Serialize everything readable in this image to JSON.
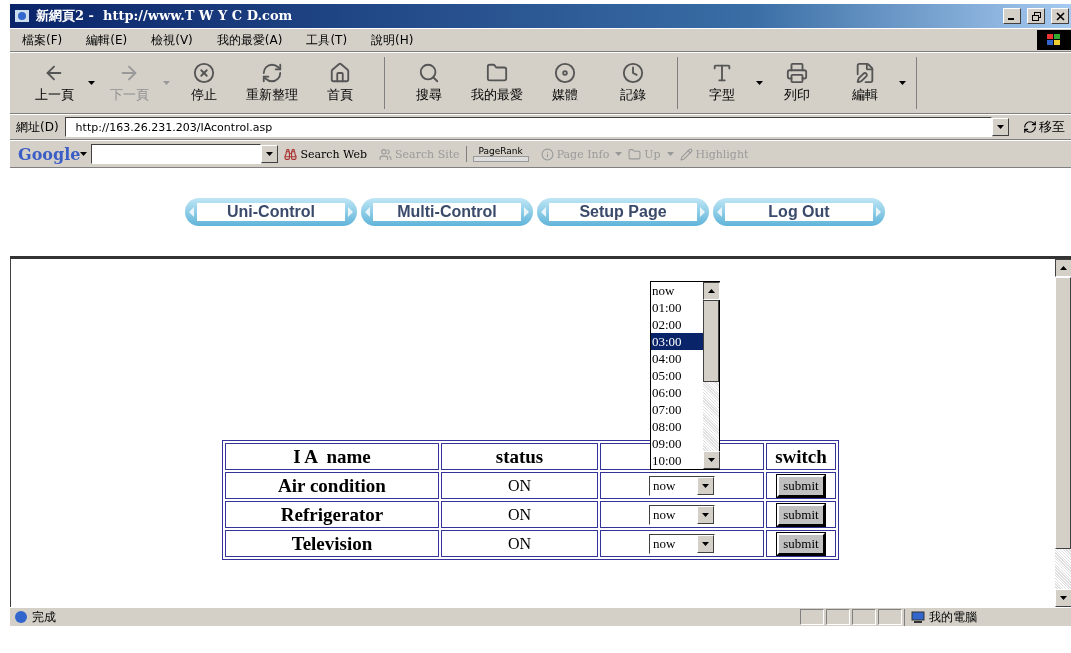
{
  "window": {
    "title": "新網頁2 -  http://www.T W Y C D.com"
  },
  "menu": [
    "檔案(F)",
    "編輯(E)",
    "檢視(V)",
    "我的最愛(A)",
    "工具(T)",
    "說明(H)"
  ],
  "toolbar": [
    [
      {
        "kind": "back",
        "label": "上一頁",
        "has_menu": true,
        "disabled": false
      },
      {
        "kind": "forward",
        "label": "下一頁",
        "has_menu": true,
        "disabled": true
      },
      {
        "kind": "stop",
        "label": "停止",
        "has_menu": false,
        "disabled": false
      },
      {
        "kind": "refresh",
        "label": "重新整理",
        "has_menu": false,
        "disabled": false
      },
      {
        "kind": "home",
        "label": "首頁",
        "has_menu": false,
        "disabled": false
      }
    ],
    [
      {
        "kind": "search",
        "label": "搜尋",
        "has_menu": false,
        "disabled": false
      },
      {
        "kind": "favorites",
        "label": "我的最愛",
        "has_menu": false,
        "disabled": false
      },
      {
        "kind": "media",
        "label": "媒體",
        "has_menu": false,
        "disabled": false
      },
      {
        "kind": "history",
        "label": "記錄",
        "has_menu": false,
        "disabled": false
      }
    ],
    [
      {
        "kind": "font",
        "label": "字型",
        "has_menu": true,
        "disabled": false
      },
      {
        "kind": "print",
        "label": "列印",
        "has_menu": false,
        "disabled": false
      },
      {
        "kind": "edit",
        "label": "編輯",
        "has_menu": true,
        "disabled": false
      }
    ]
  ],
  "address": {
    "label": "網址(D)",
    "value": "http://163.26.231.203/IAcontrol.asp",
    "go": "移至"
  },
  "google_bar": {
    "logo": "Google",
    "items": [
      {
        "kind": "search-web",
        "label": "Search Web",
        "disabled": false,
        "has_menu": false
      },
      {
        "kind": "search-site",
        "label": "Search Site",
        "disabled": true,
        "has_menu": false
      },
      {
        "kind": "pagerank",
        "label": "PageRank",
        "level": 0
      },
      {
        "kind": "page-info",
        "label": "Page Info",
        "disabled": true,
        "has_menu": true
      },
      {
        "kind": "up",
        "label": "Up",
        "disabled": true,
        "has_menu": true
      },
      {
        "kind": "highlight",
        "label": "Highlight",
        "disabled": true,
        "has_menu": false
      }
    ]
  },
  "nav": [
    "Uni-Control",
    "Multi-Control",
    "Setup Page",
    "Log Out"
  ],
  "table": {
    "columns": [
      {
        "kind": "label",
        "label": "I A  name"
      },
      {
        "kind": "label",
        "label": "status"
      },
      {
        "kind": "covered"
      },
      {
        "kind": "label",
        "label": "switch"
      }
    ],
    "rows": [
      {
        "name": "Air condition",
        "status": "ON",
        "time": "now",
        "button": "submit"
      },
      {
        "name": "Refrigerator",
        "status": "ON",
        "time": "now",
        "button": "submit"
      },
      {
        "name": "Television",
        "status": "ON",
        "time": "now",
        "button": "submit"
      }
    ],
    "open_list": [
      {
        "label": "now",
        "selected": false
      },
      {
        "label": "01:00",
        "selected": false
      },
      {
        "label": "02:00",
        "selected": false
      },
      {
        "label": "03:00",
        "selected": true
      },
      {
        "label": "04:00",
        "selected": false
      },
      {
        "label": "05:00",
        "selected": false
      },
      {
        "label": "06:00",
        "selected": false
      },
      {
        "label": "07:00",
        "selected": false
      },
      {
        "label": "08:00",
        "selected": false
      },
      {
        "label": "09:00",
        "selected": false
      },
      {
        "label": "10:00",
        "selected": false
      }
    ]
  },
  "status_bar": {
    "text": "完成",
    "zone": "我的電腦"
  }
}
